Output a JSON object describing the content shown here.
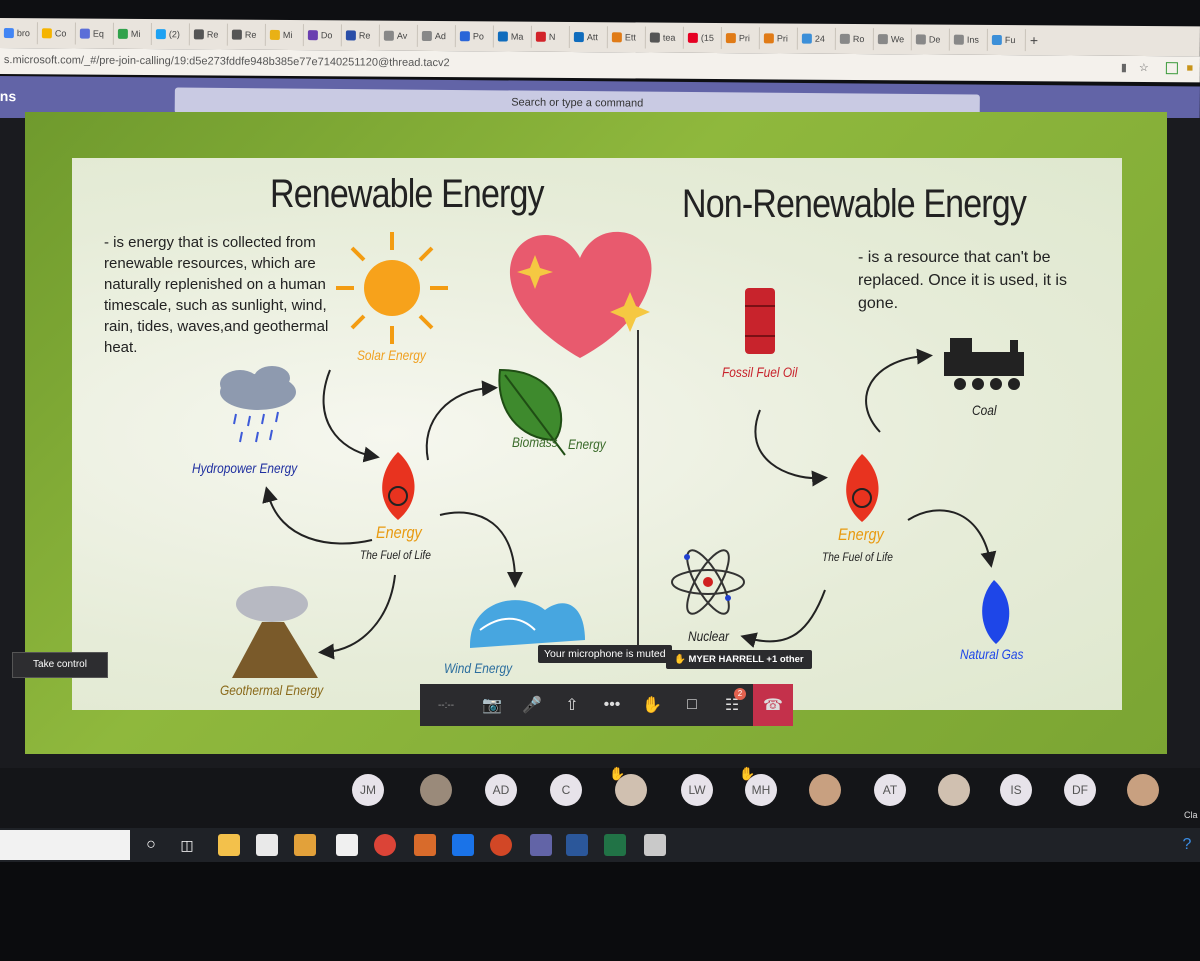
{
  "browser": {
    "tabs": [
      {
        "label": "bro",
        "color": "#4285f4"
      },
      {
        "label": "Co",
        "color": "#f5b400"
      },
      {
        "label": "Eq",
        "color": "#5b6ed8"
      },
      {
        "label": "Mi",
        "color": "#31a24c"
      },
      {
        "label": "(2)",
        "color": "#1da1f2"
      },
      {
        "label": "Re",
        "color": "#555555"
      },
      {
        "label": "Re",
        "color": "#555555"
      },
      {
        "label": "Mi",
        "color": "#e9b115"
      },
      {
        "label": "Do",
        "color": "#6a3fb0"
      },
      {
        "label": "Re",
        "color": "#2a4ea8"
      },
      {
        "label": "Av",
        "color": "#888888"
      },
      {
        "label": "Ad",
        "color": "#888888"
      },
      {
        "label": "Po",
        "color": "#2a65d8"
      },
      {
        "label": "Ma",
        "color": "#0f6cbd"
      },
      {
        "label": "N",
        "color": "#d2232a"
      },
      {
        "label": "Att",
        "color": "#0f6cbd"
      },
      {
        "label": "Ett",
        "color": "#e07b17"
      },
      {
        "label": "tea",
        "color": "#555555"
      },
      {
        "label": "(15",
        "color": "#e60023"
      },
      {
        "label": "Pri",
        "color": "#e07b17"
      },
      {
        "label": "Pri",
        "color": "#e07b17"
      },
      {
        "label": "24",
        "color": "#3c8fd8"
      },
      {
        "label": "Ro",
        "color": "#888888"
      },
      {
        "label": "We",
        "color": "#888888"
      },
      {
        "label": "De",
        "color": "#888888"
      },
      {
        "label": "Ins",
        "color": "#888888"
      },
      {
        "label": "Fu",
        "color": "#3c8fd8"
      }
    ],
    "new_tab": "+",
    "url": "s.microsoft.com/_#/pre-join-calling/19:d5e273fddfe948b385e77e7140251120@thread.tacv2"
  },
  "teams": {
    "title": "ns",
    "search_placeholder": "Search or type a command"
  },
  "slide": {
    "renewable_title": "Renewable Energy",
    "nonrenewable_title": "Non-Renewable Energy",
    "renewable_desc": "- is energy that is collected from renewable resources, which are naturally replenished on a human timescale, such as sunlight, wind, rain, tides, waves,and geothermal heat.",
    "nonrenewable_desc": "- is a resource that can't be replaced. Once it is used, it is gone.",
    "renewable_labels": {
      "solar": "Solar Energy",
      "biomass": "Biomass",
      "biomass2": "Energy",
      "hydro": "Hydropower Energy",
      "energy": "Energy",
      "fuel": "The Fuel of Life",
      "geothermal": "Geothermal Energy",
      "wind": "Wind Energy"
    },
    "nonrenewable_labels": {
      "oil": "Fossil Fuel Oil",
      "coal": "Coal",
      "energy": "Energy",
      "fuel": "The Fuel of Life",
      "nuclear": "Nuclear",
      "gas": "Natural Gas"
    }
  },
  "meeting": {
    "take_control": "Take control",
    "mic_tooltip": "Your microphone is muted",
    "raised_hands": "MYER HARRELL +1 other",
    "timer": "--:--",
    "participants_badge": "2",
    "participants": [
      {
        "initials": "JM",
        "hand": false
      },
      {
        "initials": "",
        "hand": false
      },
      {
        "initials": "AD",
        "hand": false
      },
      {
        "initials": "C",
        "hand": false
      },
      {
        "initials": "",
        "hand": true
      },
      {
        "initials": "LW",
        "hand": false
      },
      {
        "initials": "MH",
        "hand": true
      },
      {
        "initials": "",
        "hand": false
      },
      {
        "initials": "AT",
        "hand": false
      },
      {
        "initials": "",
        "hand": false
      },
      {
        "initials": "IS",
        "hand": false
      },
      {
        "initials": "DF",
        "hand": false
      },
      {
        "initials": "",
        "hand": false
      }
    ],
    "side_label": "Cla"
  },
  "colors": {
    "teams_purple": "#6264a7",
    "hangup_red": "#c4314b",
    "slide_green": "#7ba533"
  }
}
